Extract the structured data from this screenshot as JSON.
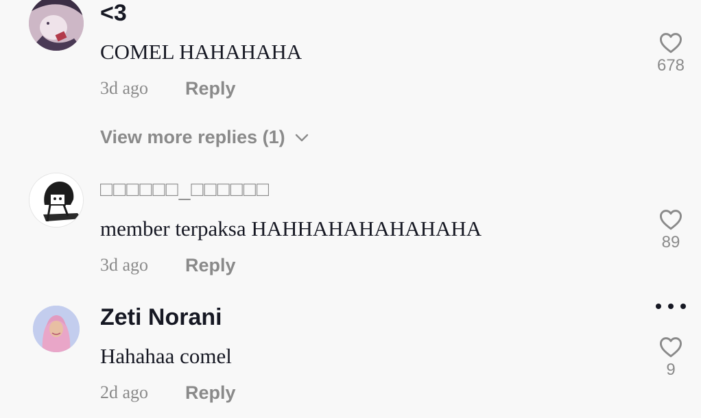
{
  "comments": [
    {
      "username": "<3",
      "text": "COMEL HAHAHAHA",
      "time": "3d ago",
      "reply_label": "Reply",
      "likes": "678",
      "view_more": "View more replies (1)"
    },
    {
      "username": "□□□□□□_□□□□□□",
      "text": "member terpaksa HAHHAHAHAHAHAHA",
      "time": "3d ago",
      "reply_label": "Reply",
      "likes": "89"
    },
    {
      "username": "Zeti Norani",
      "text": "Hahahaa comel",
      "time": "2d ago",
      "reply_label": "Reply",
      "likes": "9"
    }
  ],
  "icons": {
    "like": "heart-outline-icon",
    "expand": "chevron-down-icon",
    "more": "more-horizontal-icon"
  },
  "colors": {
    "background": "#f8f8f8",
    "primary_text": "#161823",
    "secondary_text": "#8a8a8a"
  }
}
